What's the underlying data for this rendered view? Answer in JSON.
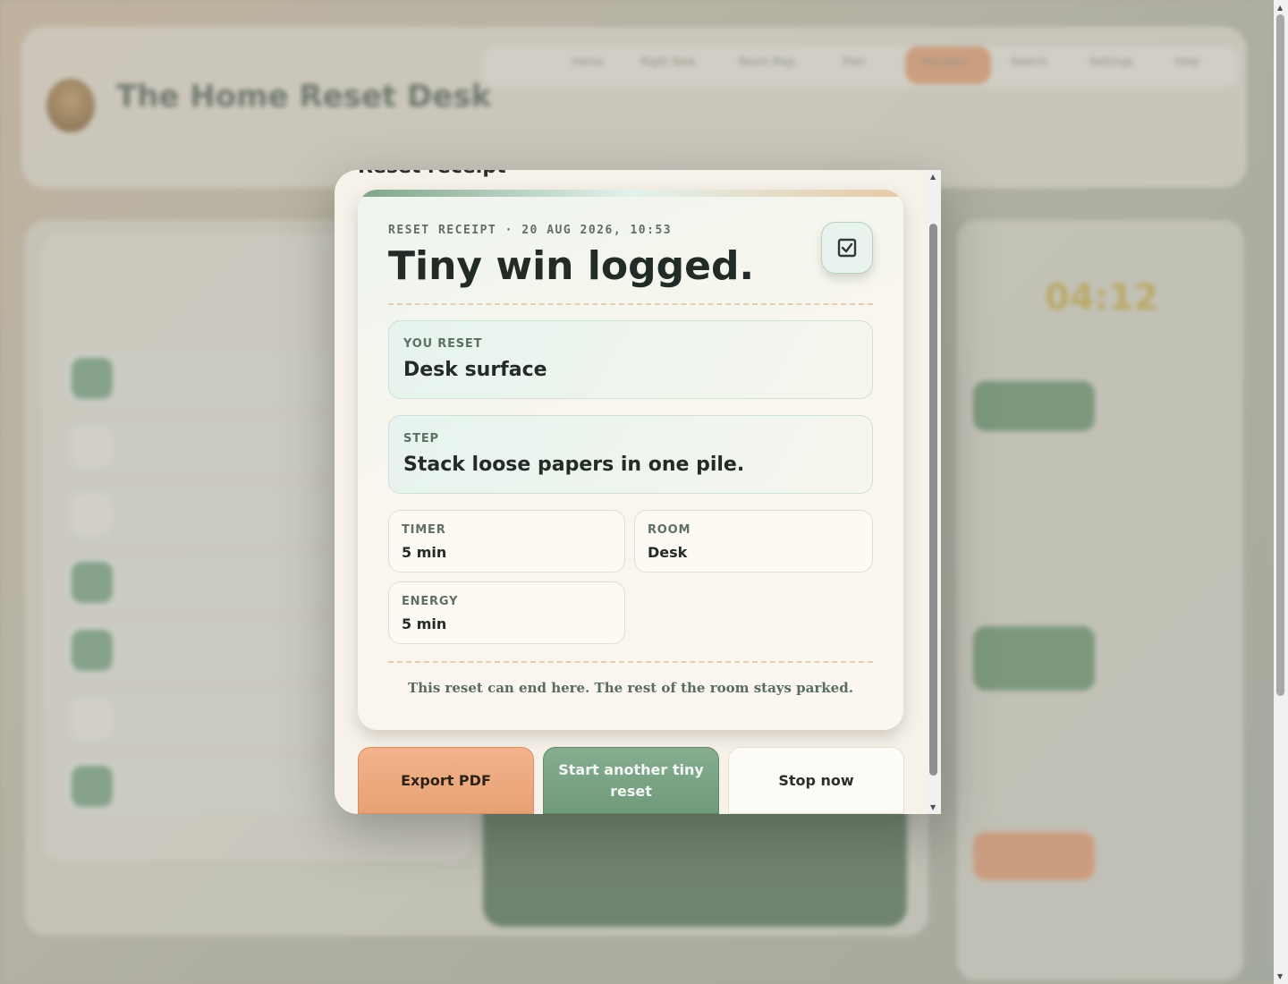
{
  "background": {
    "app_title": "The Home Reset Desk",
    "nav_items": [
      "Home",
      "Right Now",
      "Room Map",
      "Plan",
      "Receipts",
      "Search",
      "Settings",
      "Help"
    ],
    "timer_value": "04:12"
  },
  "modal": {
    "heading": "Reset receipt",
    "receipt": {
      "meta": "RESET RECEIPT · 20 AUG 2026, 10:53",
      "title": "Tiny win logged.",
      "check_icon": "checkbox-icon",
      "you_reset_label": "YOU RESET",
      "you_reset_value": "Desk surface",
      "step_label": "STEP",
      "step_value": "Stack loose papers in one pile.",
      "timer_label": "TIMER",
      "timer_value": "5 min",
      "room_label": "ROOM",
      "room_value": "Desk",
      "energy_label": "ENERGY",
      "energy_value": "5 min",
      "note": "This reset can end here. The rest of the room stays parked."
    },
    "actions": {
      "export": "Export PDF",
      "again": "Start another tiny reset",
      "stop": "Stop now"
    }
  },
  "colors": {
    "accent_green": "#6f9a7a",
    "accent_orange": "#e8a173",
    "card_bg": "#fbf7ee"
  }
}
